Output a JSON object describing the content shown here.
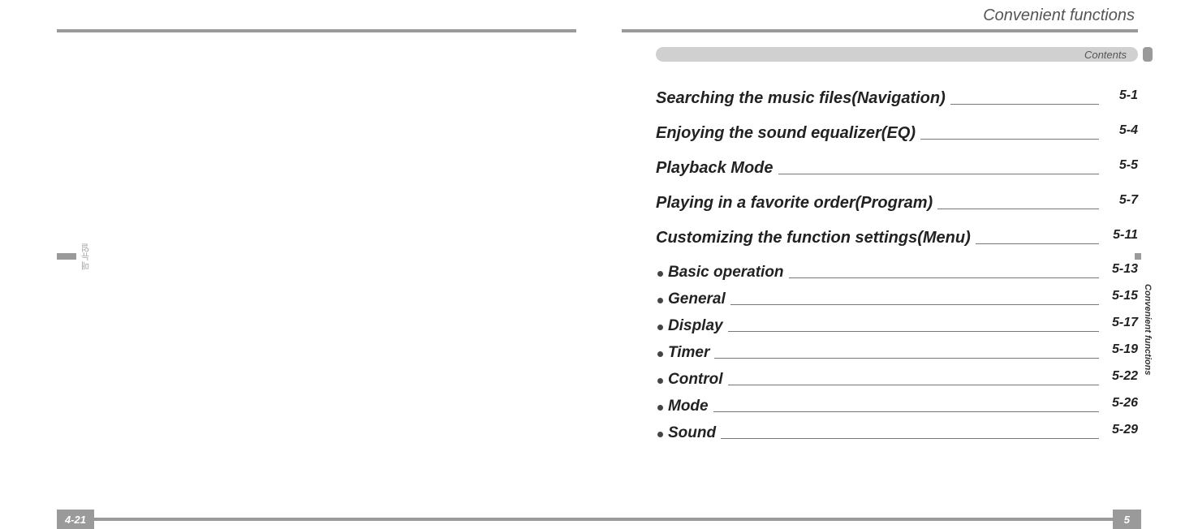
{
  "left": {
    "side_text": "매뉴얼",
    "page_number": "4-21"
  },
  "right": {
    "header_title": "Convenient functions",
    "contents_label": "Contents",
    "side_text": "Convenient functions",
    "page_number": "5",
    "toc": [
      {
        "type": "major",
        "label": "Searching the music files(Navigation)",
        "page": "5-1"
      },
      {
        "type": "major",
        "label": "Enjoying the sound equalizer(EQ)",
        "page": "5-4"
      },
      {
        "type": "major",
        "label": "Playback Mode",
        "page": "5-5"
      },
      {
        "type": "major",
        "label": "Playing in a favorite order(Program)",
        "page": "5-7"
      },
      {
        "type": "major",
        "label": "Customizing the function settings(Menu)",
        "page": "5-11"
      },
      {
        "type": "minor",
        "label": "Basic operation",
        "page": "5-13"
      },
      {
        "type": "minor",
        "label": "General",
        "page": "5-15"
      },
      {
        "type": "minor",
        "label": "Display",
        "page": "5-17"
      },
      {
        "type": "minor",
        "label": "Timer",
        "page": "5-19"
      },
      {
        "type": "minor",
        "label": "Control",
        "page": "5-22"
      },
      {
        "type": "minor",
        "label": "Mode",
        "page": "5-26"
      },
      {
        "type": "minor",
        "label": "Sound",
        "page": "5-29"
      }
    ]
  }
}
